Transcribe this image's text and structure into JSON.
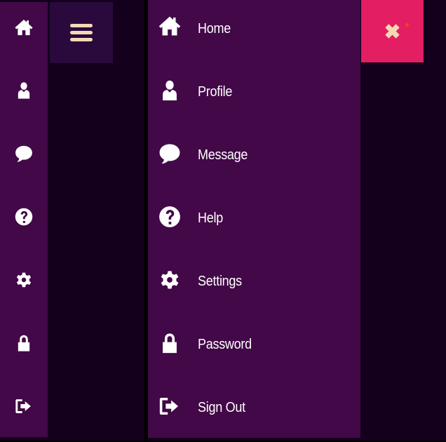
{
  "colors": {
    "rail_bg": "#420847",
    "drawer_bg": "#420847",
    "backdrop": "#14001c",
    "hamburger_bg": "#2a0a3c",
    "hamburger_bars": "#f5d9b5",
    "close_bg": "#e31e63",
    "icon": "#ffffff"
  },
  "rail": {
    "items": [
      {
        "icon": "home-icon"
      },
      {
        "icon": "user-icon"
      },
      {
        "icon": "chat-bubble-icon"
      },
      {
        "icon": "help-icon"
      },
      {
        "icon": "gear-icon"
      },
      {
        "icon": "lock-icon"
      },
      {
        "icon": "sign-out-icon"
      }
    ]
  },
  "hamburger": {
    "icon": "hamburger-icon"
  },
  "drawer": {
    "items": [
      {
        "label": "Home",
        "icon": "home-icon"
      },
      {
        "label": "Profile",
        "icon": "user-icon"
      },
      {
        "label": "Message",
        "icon": "chat-bubble-icon"
      },
      {
        "label": "Help",
        "icon": "help-icon"
      },
      {
        "label": "Settings",
        "icon": "gear-icon"
      },
      {
        "label": "Password",
        "icon": "lock-icon"
      },
      {
        "label": "Sign Out",
        "icon": "sign-out-icon"
      }
    ]
  },
  "close_button": {
    "icon": "close-icon"
  }
}
